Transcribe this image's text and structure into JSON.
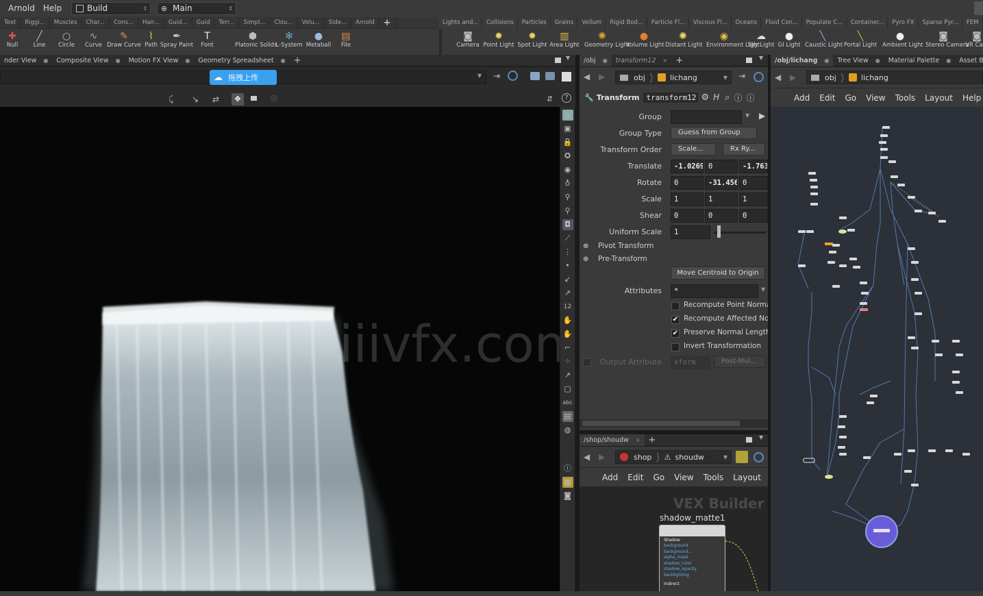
{
  "menu": {
    "items": [
      "Arnold",
      "Help"
    ],
    "desktop": "Build",
    "context": "Main"
  },
  "shelf_tabs": [
    "Text",
    "Riggi...",
    "Muscles",
    "Char...",
    "Cons...",
    "Hair...",
    "Guid...",
    "Guid",
    "Terr...",
    "Simpl...",
    "Clou...",
    "Volu...",
    "Side...",
    "Arnold",
    "Lights and...",
    "Collisions",
    "Particles",
    "Grains",
    "Vellum",
    "Rigid Bod...",
    "Particle Fl...",
    "Viscous Fl...",
    "Oceans",
    "Fluid Con...",
    "Populate C...",
    "Container...",
    "Pyro FX",
    "Sparse Pyr...",
    "FEM"
  ],
  "shelf_tools_left": [
    {
      "label": "Null",
      "icon": "null-icon"
    },
    {
      "label": "Line",
      "icon": "line-icon"
    },
    {
      "label": "Circle",
      "icon": "circle-icon"
    },
    {
      "label": "Curve",
      "icon": "curve-icon"
    },
    {
      "label": "Draw Curve",
      "icon": "draw-curve-icon"
    },
    {
      "label": "Path",
      "icon": "path-icon"
    },
    {
      "label": "Spray Paint",
      "icon": "spray-paint-icon"
    },
    {
      "label": "Font",
      "icon": "font-icon"
    },
    {
      "label": "Platonic Solids",
      "icon": "platonic-solids-icon"
    },
    {
      "label": "L-System",
      "icon": "l-system-icon"
    },
    {
      "label": "Metaball",
      "icon": "metaball-icon"
    },
    {
      "label": "File",
      "icon": "file-icon"
    }
  ],
  "shelf_tools_right": [
    {
      "label": "Camera",
      "icon": "camera-icon"
    },
    {
      "label": "Point Light",
      "icon": "point-light-icon"
    },
    {
      "label": "Spot Light",
      "icon": "spot-light-icon"
    },
    {
      "label": "Area Light",
      "icon": "area-light-icon"
    },
    {
      "label": "Geometry Light",
      "icon": "geometry-light-icon"
    },
    {
      "label": "Volume Light",
      "icon": "volume-light-icon"
    },
    {
      "label": "Distant Light",
      "icon": "distant-light-icon"
    },
    {
      "label": "Environment Light",
      "icon": "environment-light-icon"
    },
    {
      "label": "Sky Light",
      "icon": "sky-light-icon"
    },
    {
      "label": "GI Light",
      "icon": "gi-light-icon"
    },
    {
      "label": "Caustic Light",
      "icon": "caustic-light-icon"
    },
    {
      "label": "Portal Light",
      "icon": "portal-light-icon"
    },
    {
      "label": "Ambient Light",
      "icon": "ambient-light-icon"
    },
    {
      "label": "Stereo Camera",
      "icon": "stereo-camera-icon"
    },
    {
      "label": "VR Ca...",
      "icon": "vr-camera-icon"
    }
  ],
  "viewport_tabs": [
    "nder View",
    "Composite View",
    "Motion FX View",
    "Geometry Spreadsheet"
  ],
  "upload_badge": "拖拽上传",
  "watermark": "iiivfx.com",
  "param_tabs": [
    "/obj",
    "transform12"
  ],
  "param_path": {
    "root": "obj",
    "node": "lichang"
  },
  "param_header": {
    "type": "Transform",
    "name": "transform12"
  },
  "params": {
    "group_label": "Group",
    "group_value": "",
    "group_type_label": "Group Type",
    "group_type_value": "Guess from Group",
    "transform_order_label": "Transform Order",
    "transform_order_a": "Scale...",
    "transform_order_b": "Rx Ry...",
    "translate_label": "Translate",
    "translate": [
      "-1.0269",
      "0",
      "-1.763"
    ],
    "rotate_label": "Rotate",
    "rotate": [
      "0",
      "-31.456",
      "0"
    ],
    "scale_label": "Scale",
    "scale": [
      "1",
      "1",
      "1"
    ],
    "shear_label": "Shear",
    "shear": [
      "0",
      "0",
      "0"
    ],
    "uniform_scale_label": "Uniform Scale",
    "uniform_scale": "1",
    "pivot_label": "Pivot Transform",
    "pretransform_label": "Pre-Transform",
    "move_centroid": "Move Centroid to Origin",
    "attributes_label": "Attributes",
    "attributes_value": "*",
    "checks": [
      {
        "label": "Recompute Point Normal",
        "checked": false
      },
      {
        "label": "Recompute Affected Nor...",
        "checked": true
      },
      {
        "label": "Preserve Normal Length",
        "checked": true
      },
      {
        "label": "Invert Transformation",
        "checked": false
      }
    ],
    "output_attr_label": "Output Attribute",
    "output_attr_value": "xform",
    "output_attr_b": "Post-Mul..."
  },
  "shop_tabs": [
    "/shop/shoudw"
  ],
  "shop_path": {
    "root": "shop",
    "node": "shoudw"
  },
  "shop_menu": [
    "Add",
    "Edit",
    "Go",
    "View",
    "Tools",
    "Layout"
  ],
  "vex": {
    "title": "VEX Builder",
    "node_name": "shadow_matte1",
    "node_label": "Shadow",
    "params": [
      "background",
      "background...",
      "alpha_mask",
      "shadow_color",
      "shadow_opacity",
      "backlighting"
    ],
    "footer": "Indirect"
  },
  "net_tabs": [
    "/obj/lichang",
    "Tree View",
    "Material Palette",
    "Asset Brows..."
  ],
  "net_path": {
    "root": "obj",
    "node": "lichang"
  },
  "net_menu": [
    "Add",
    "Edit",
    "Go",
    "View",
    "Tools",
    "Layout",
    "Help"
  ],
  "colors": {
    "accent": "#3a8ee6",
    "highlight": "#e8c13a",
    "network_bg": "#2c3038",
    "wire": "#5a86c8"
  }
}
